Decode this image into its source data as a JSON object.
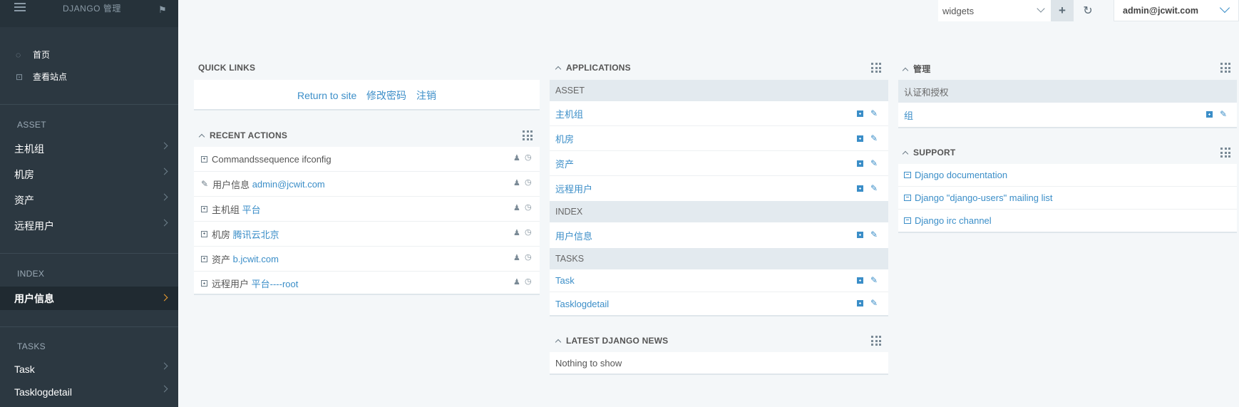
{
  "brand": "DJANGO 管理",
  "sidebar": {
    "links": [
      {
        "label": "首页",
        "icon": "home-circle-icon"
      },
      {
        "label": "查看站点",
        "icon": "view-site-icon"
      }
    ],
    "sections": [
      {
        "title": "ASSET",
        "items": [
          "主机组",
          "机房",
          "资产",
          "远程用户"
        ]
      },
      {
        "title": "INDEX",
        "items": [
          "用户信息"
        ]
      },
      {
        "title": "TASKS",
        "items": [
          "Task",
          "Tasklogdetail"
        ]
      }
    ],
    "active_item": "用户信息"
  },
  "topbar": {
    "widget_select": "widgets",
    "user": "admin@jcwit.com"
  },
  "quick_links": {
    "title": "QUICK LINKS",
    "links": [
      "Return to site",
      "修改密码",
      "注销"
    ]
  },
  "recent_actions": {
    "title": "RECENT ACTIONS",
    "rows": [
      {
        "type": "add",
        "model": "",
        "object": "Commandssequence ifconfig"
      },
      {
        "type": "change",
        "model": "用户信息",
        "object": "admin@jcwit.com"
      },
      {
        "type": "add",
        "model": "主机组",
        "object": "平台"
      },
      {
        "type": "add",
        "model": "机房",
        "object": "腾讯云北京"
      },
      {
        "type": "add",
        "model": "资产",
        "object": "b.jcwit.com"
      },
      {
        "type": "add",
        "model": "远程用户",
        "object": "平台----root"
      }
    ]
  },
  "applications": {
    "title": "APPLICATIONS",
    "groups": [
      {
        "name": "ASSET",
        "models": [
          "主机组",
          "机房",
          "资产",
          "远程用户"
        ]
      },
      {
        "name": "INDEX",
        "models": [
          "用户信息"
        ]
      },
      {
        "name": "TASKS",
        "models": [
          "Task",
          "Tasklogdetail"
        ]
      }
    ]
  },
  "latest_news": {
    "title": "LATEST DJANGO NEWS",
    "empty": "Nothing to show"
  },
  "admin_panel": {
    "title": "管理",
    "group": "认证和授权",
    "models": [
      "组"
    ]
  },
  "support": {
    "title": "SUPPORT",
    "links": [
      "Django documentation",
      "Django \"django-users\" mailing list",
      "Django irc channel"
    ]
  },
  "colors": {
    "sidebar_bg": "#2c3841",
    "link": "#3b8ec8",
    "page_bg": "#f4f7f9",
    "active_chevron": "#f0a030"
  }
}
